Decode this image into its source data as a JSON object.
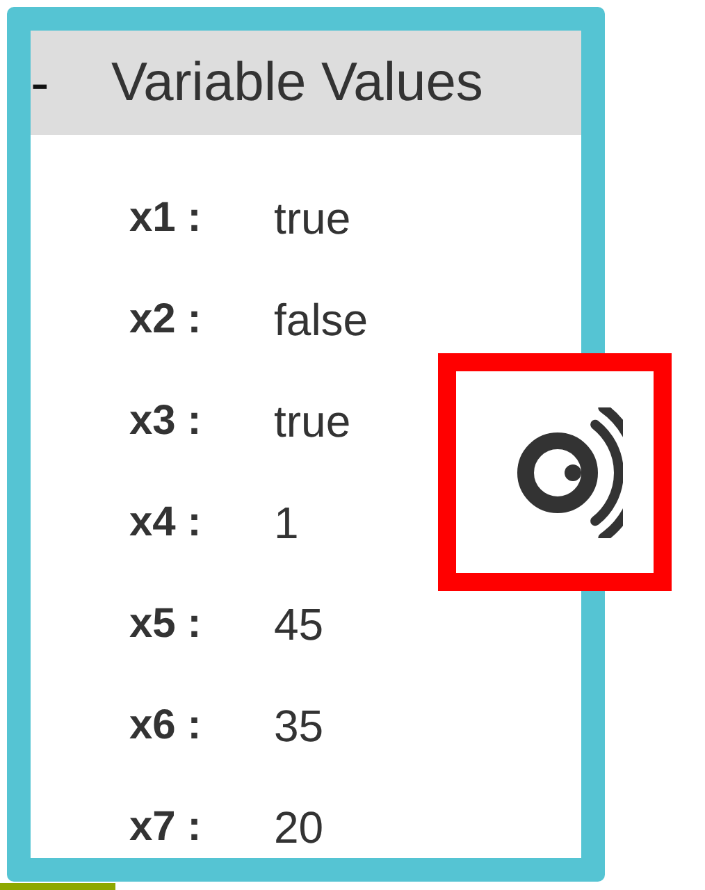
{
  "panel": {
    "toggle": "-",
    "title": "Variable Values",
    "variables": [
      {
        "name": "x1 :",
        "value": "true"
      },
      {
        "name": "x2 :",
        "value": "false"
      },
      {
        "name": "x3 :",
        "value": "true"
      },
      {
        "name": "x4 :",
        "value": "1"
      },
      {
        "name": "x5 :",
        "value": "45"
      },
      {
        "name": "x6 :",
        "value": "35"
      },
      {
        "name": "x7 :",
        "value": "20"
      }
    ]
  }
}
